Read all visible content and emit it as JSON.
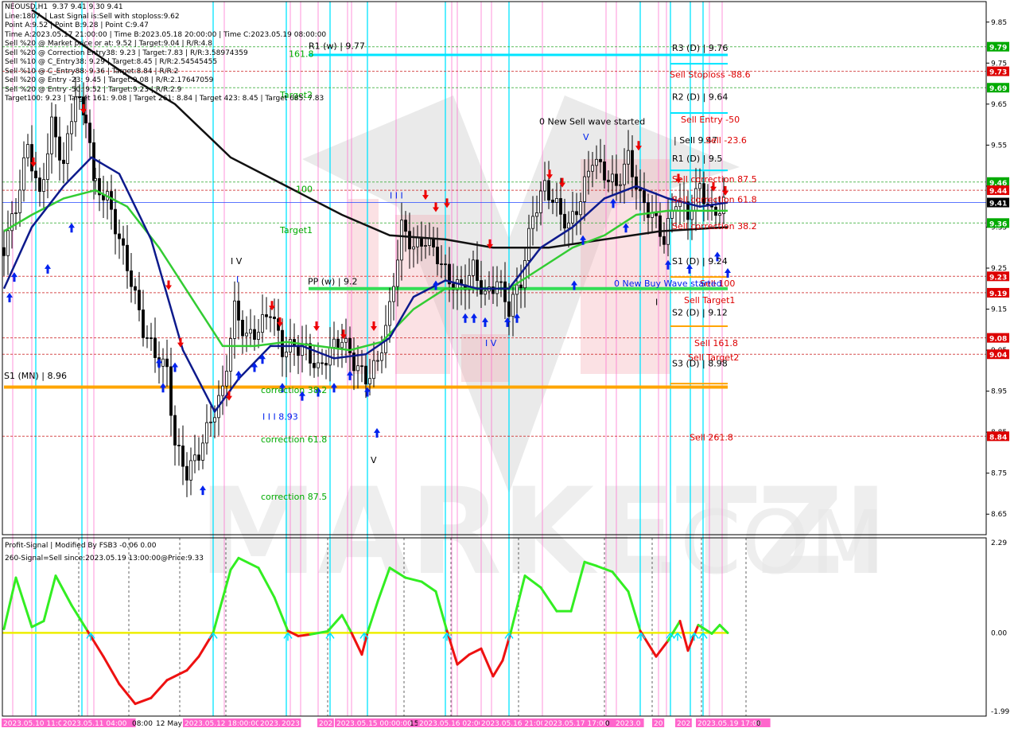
{
  "header": {
    "lines": [
      "NEOUSD,H1  9.37 9.41 9.30 9.41",
      "Line:1807  | Last Signal is:Sell with stoploss:9.62",
      "Point A:9.52 | Point B:9.28 | Point C:9.47",
      "Time A:2023.05.17 21:00:00 | Time B:2023.05.18 20:00:00 | Time C:2023.05.19 08:00:00",
      "Sell %20 @ Market price or at: 9.52 | Target:9.04 | R/R:4.8",
      "Sell %20 @ Correction Entry38: 9.23 | Target:7.83 | R/R:3.58974359",
      "Sell %10 @ C_Entry38: 9.29 | Target:8.45 | R/R:2.54545455",
      "Sell %10 @ C_Entry88: 9.36 | Target:8.84 | R/R:2",
      "Sell %20 @ Entry -23: 9.45 | Target:9.08 | R/R:2.17647059",
      "Sell %20 @ Entry -50: 9.52 | Target:9.23 | R/R:2.9",
      "Target100: 9.23 | Target 161: 9.08 | Target 261: 8.84 | Target 423: 8.45 | Target 685: 7.83"
    ]
  },
  "colors": {
    "background": "#ffffff",
    "pink_band": "#f4a8b3",
    "cyan_line": "#00e5ff",
    "magenta_line": "#ff66cc",
    "ema_black": "#111111",
    "ema_navy": "#0d1a8c",
    "ema_green": "#33cc33",
    "orange_support": "#ffa500",
    "pivot_green": "#33dd55",
    "signal_green": "#33ee22",
    "signal_red": "#ee1111",
    "zero_line": "#eeee00",
    "arrow_up": "#0022ee",
    "arrow_down": "#ee0000",
    "tag_green": "#00aa00",
    "tag_red": "#dd0000",
    "tag_current": "#000000",
    "watermark": "#e8e8e8"
  },
  "chart_data": [
    {
      "type": "candlestick",
      "symbol": "NEOUSD",
      "timeframe": "H1",
      "ylim": [
        8.6,
        9.9
      ],
      "y_ticks": [
        "9.85",
        "9.75",
        "9.65",
        "9.55",
        "9.45",
        "9.35",
        "9.25",
        "9.15",
        "9.05",
        "8.95",
        "8.85",
        "8.75",
        "8.65"
      ],
      "price_tags": [
        {
          "text": "9.79",
          "value": 9.79,
          "kind": "green"
        },
        {
          "text": "9.73",
          "value": 9.73,
          "kind": "red"
        },
        {
          "text": "9.69",
          "value": 9.69,
          "kind": "green"
        },
        {
          "text": "9.46",
          "value": 9.46,
          "kind": "green"
        },
        {
          "text": "9.44",
          "value": 9.44,
          "kind": "red"
        },
        {
          "text": "9.41",
          "value": 9.41,
          "kind": "current"
        },
        {
          "text": "9.36",
          "value": 9.36,
          "kind": "green"
        },
        {
          "text": "9.23",
          "value": 9.23,
          "kind": "red"
        },
        {
          "text": "9.19",
          "value": 9.19,
          "kind": "red"
        },
        {
          "text": "9.08",
          "value": 9.08,
          "kind": "red"
        },
        {
          "text": "9.04",
          "value": 9.04,
          "kind": "red"
        },
        {
          "text": "8.84",
          "value": 8.84,
          "kind": "red"
        }
      ],
      "annotations": [
        {
          "text": "R1 (w) | 9.77",
          "x": 388,
          "value": 9.785,
          "color": "#000000"
        },
        {
          "text": "161.8",
          "x": 363,
          "value": 9.765,
          "color": "#00aa00"
        },
        {
          "text": "R3 (D) | 9.76",
          "x": 845,
          "value": 9.78,
          "color": "#000000"
        },
        {
          "text": "Sell Stoploss -88.6",
          "x": 842,
          "value": 9.715,
          "color": "#dd0000"
        },
        {
          "text": "R2 (D) | 9.64",
          "x": 845,
          "value": 9.66,
          "color": "#000000"
        },
        {
          "text": "Target2",
          "x": 352,
          "value": 9.665,
          "color": "#00aa00"
        },
        {
          "text": "0 New Sell wave started",
          "x": 678,
          "value": 9.6,
          "color": "#000000"
        },
        {
          "text": "Sell Entry -50",
          "x": 856,
          "value": 9.605,
          "color": "#dd0000"
        },
        {
          "text": "| Sell 9.47",
          "x": 847,
          "value": 9.555,
          "color": "#000000"
        },
        {
          "text": "Sell -23.6",
          "x": 887,
          "value": 9.555,
          "color": "#dd0000"
        },
        {
          "text": "V",
          "x": 733,
          "value": 9.562,
          "color": "#0022ee"
        },
        {
          "text": "R1 (D) | 9.5",
          "x": 845,
          "value": 9.51,
          "color": "#000000"
        },
        {
          "text": "Sell correction 87.5",
          "x": 845,
          "value": 9.46,
          "color": "#dd0000"
        },
        {
          "text": "100",
          "x": 372,
          "value": 9.435,
          "color": "#00aa00"
        },
        {
          "text": "I I I",
          "x": 490,
          "value": 9.42,
          "color": "#0022ee"
        },
        {
          "text": "Sell correction 61.8",
          "x": 845,
          "value": 9.41,
          "color": "#dd0000"
        },
        {
          "text": "Sell correction 38.2",
          "x": 845,
          "value": 9.345,
          "color": "#dd0000"
        },
        {
          "text": "Target1",
          "x": 352,
          "value": 9.335,
          "color": "#00aa00"
        },
        {
          "text": "I V",
          "x": 290,
          "value": 9.26,
          "color": "#000000"
        },
        {
          "text": "S1 (D) | 9.24",
          "x": 845,
          "value": 9.26,
          "color": "#000000"
        },
        {
          "text": "I",
          "x": 297,
          "value": 9.215,
          "color": "#0022ee"
        },
        {
          "text": "PP (w) | 9.2",
          "x": 387,
          "value": 9.21,
          "color": "#000000"
        },
        {
          "text": "Sell 100",
          "x": 880,
          "value": 9.205,
          "color": "#dd0000"
        },
        {
          "text": "0 New Buy Wave started",
          "x": 772,
          "value": 9.205,
          "color": "#0022ee"
        },
        {
          "text": "Sell Target1",
          "x": 860,
          "value": 9.165,
          "color": "#dd0000"
        },
        {
          "text": "I",
          "x": 824,
          "value": 9.16,
          "color": "#000000"
        },
        {
          "text": "S2 (D) | 9.12",
          "x": 845,
          "value": 9.135,
          "color": "#000000"
        },
        {
          "text": "I V",
          "x": 610,
          "value": 9.06,
          "color": "#0022ee"
        },
        {
          "text": "Sell 161.8",
          "x": 873,
          "value": 9.06,
          "color": "#dd0000"
        },
        {
          "text": "Sell Target2",
          "x": 865,
          "value": 9.025,
          "color": "#dd0000"
        },
        {
          "text": "S3 (D) | 8.98",
          "x": 845,
          "value": 9.01,
          "color": "#000000"
        },
        {
          "text": "S1 (MN) | 8.96",
          "x": 5,
          "value": 8.98,
          "color": "#000000"
        },
        {
          "text": "correction 38.2",
          "x": 328,
          "value": 8.945,
          "color": "#00aa00"
        },
        {
          "text": "I I I 8.93",
          "x": 330,
          "value": 8.88,
          "color": "#0022ee"
        },
        {
          "text": "Sell 261.8",
          "x": 867,
          "value": 8.83,
          "color": "#dd0000"
        },
        {
          "text": "correction 61.8",
          "x": 328,
          "value": 8.825,
          "color": "#00aa00"
        },
        {
          "text": "V",
          "x": 466,
          "value": 8.775,
          "color": "#000000"
        },
        {
          "text": "correction 87.5",
          "x": 328,
          "value": 8.685,
          "color": "#00aa00"
        }
      ]
    },
    {
      "type": "line",
      "name": "Profit-Signal | Modified By FSB3 -0.06 0.00",
      "signal_text": "260-Signal=Sell since:2023.05.19 13:00:00@Price:9.33",
      "ylim": [
        -1.99,
        2.29
      ],
      "y_ticks": [
        "2.29",
        "0.00",
        "-1.99"
      ]
    }
  ],
  "x_axis": {
    "labels": [
      {
        "text": "2023.05.10 11:00",
        "hl": true
      },
      {
        "text": "2023.05.11 04:00",
        "hl": true
      },
      {
        "text": "08:00",
        "hl": false
      },
      {
        "text": "12 May",
        "hl": false
      },
      {
        "text": "2023.05.12 18:00:00",
        "hl": true
      },
      {
        "text": "2023.",
        "hl": true
      },
      {
        "text": "2023",
        "hl": true
      },
      {
        "text": "202",
        "hl": true
      },
      {
        "text": "2023.05.15 00:00:00",
        "hl": true
      },
      {
        "text": "15",
        "hl": false
      },
      {
        "text": "2023.05.16 02:00",
        "hl": true
      },
      {
        "text": "2023.05.16 21:00",
        "hl": true
      },
      {
        "text": "2023.05.17 17:00",
        "hl": true
      },
      {
        "text": "0",
        "hl": false
      },
      {
        "text": "2023.0",
        "hl": true
      },
      {
        "text": "20",
        "hl": true
      },
      {
        "text": "202",
        "hl": true
      },
      {
        "text": "2023.05.19 17:00",
        "hl": true
      },
      {
        "text": "0",
        "hl": false
      }
    ]
  }
}
